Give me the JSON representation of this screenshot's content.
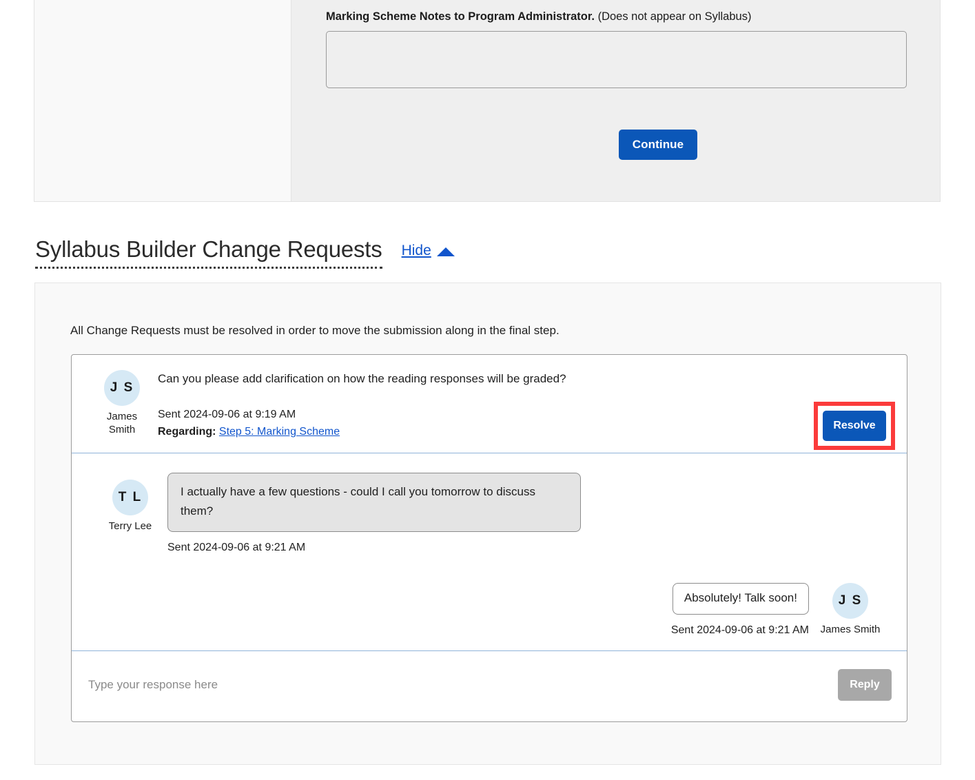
{
  "form_panel": {
    "notes_label_bold": "Marking Scheme Notes to Program Administrator.",
    "notes_label_sub": " (Does not appear on Syllabus)",
    "notes_value": "",
    "notes_placeholder": "",
    "continue_label": "Continue"
  },
  "section": {
    "title": "Syllabus Builder Change Requests",
    "hide_label": "Hide",
    "caret_icon": "caret-up-icon"
  },
  "change_requests": {
    "intro": "All Change Requests must be resolved in order to move the submission along in the final step.",
    "request": {
      "author_initials": "J S",
      "author_name": "James Smith",
      "question": "Can you please add clarification on how the reading responses will be graded?",
      "sent": "Sent 2024-09-06 at 9:19 AM",
      "regarding_label": "Regarding:",
      "regarding_link": "Step 5: Marking Scheme",
      "resolve_label": "Resolve",
      "messages": [
        {
          "direction": "incoming",
          "initials": "T L",
          "name": "Terry Lee",
          "text": "I actually have a few questions - could I call you tomorrow to discuss them?",
          "sent": "Sent 2024-09-06 at 9:21 AM"
        },
        {
          "direction": "outgoing",
          "initials": "J S",
          "name": "James Smith",
          "text": "Absolutely! Talk soon!",
          "sent": "Sent 2024-09-06 at 9:21 AM"
        }
      ],
      "reply_placeholder": "Type your response here",
      "reply_value": "",
      "reply_label": "Reply"
    }
  },
  "colors": {
    "primary_blue": "#0b57b8",
    "link_blue": "#1155cc",
    "highlight_red": "#fb3b3b",
    "avatar_blue": "#d6e9f5",
    "disabled_gray": "#a8a8a8"
  }
}
